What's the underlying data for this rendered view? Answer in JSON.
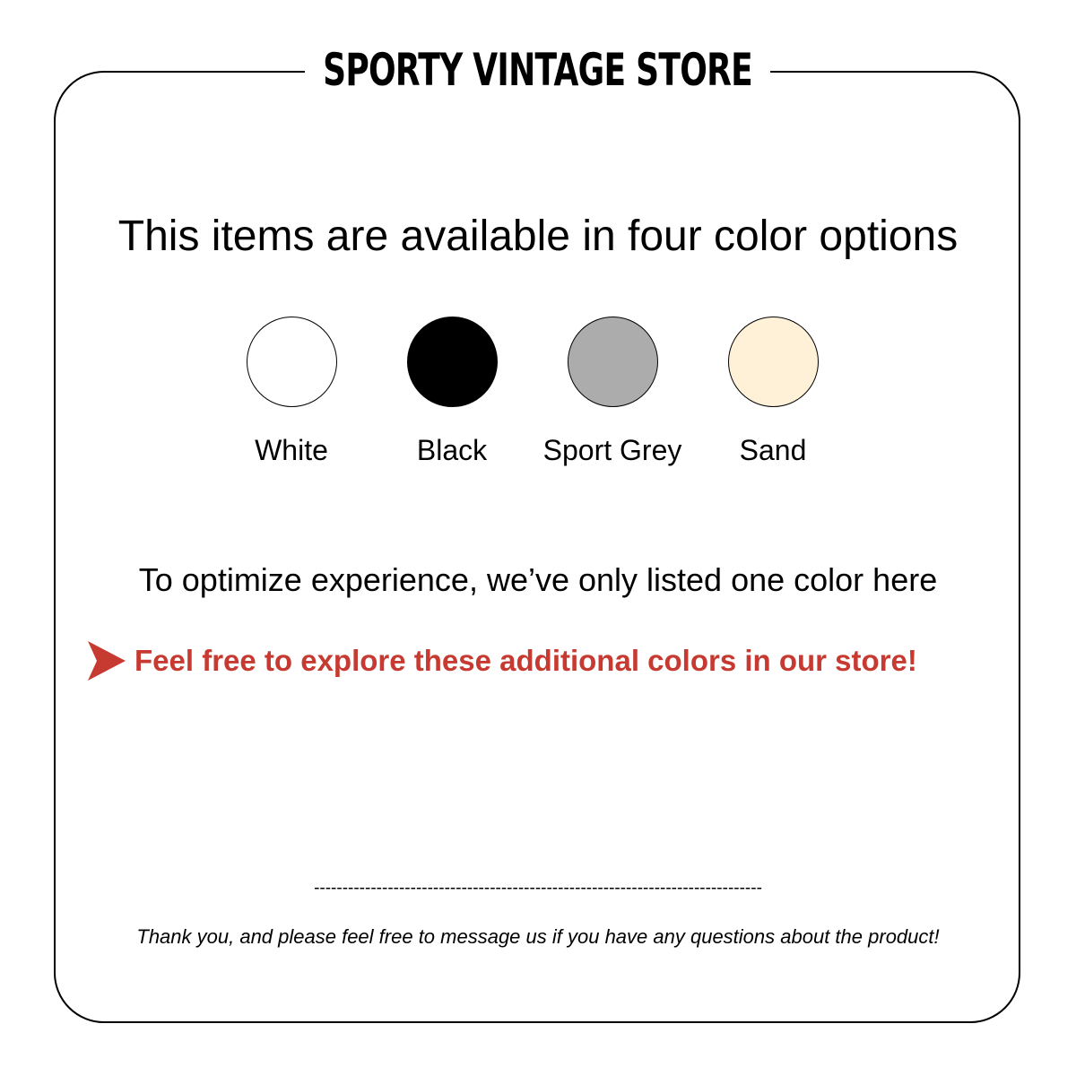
{
  "store_title": "SPORTY VINTAGE STORE",
  "headline": "This items are available in four color options",
  "colors": [
    {
      "label": "White",
      "hex": "#ffffff"
    },
    {
      "label": "Black",
      "hex": "#000000"
    },
    {
      "label": "Sport Grey",
      "hex": "#acacac"
    },
    {
      "label": "Sand",
      "hex": "#fff0d8"
    }
  ],
  "notice": "To optimize experience, we’ve only listed one color here",
  "cta": {
    "text": "Feel free to explore these additional colors in our store!",
    "color": "#c63a31",
    "icon": "arrow-right-icon"
  },
  "divider": "-------------------------------------------------------------------------------",
  "thanks": "Thank you, and please feel free to message us if you have any questions about the product!"
}
